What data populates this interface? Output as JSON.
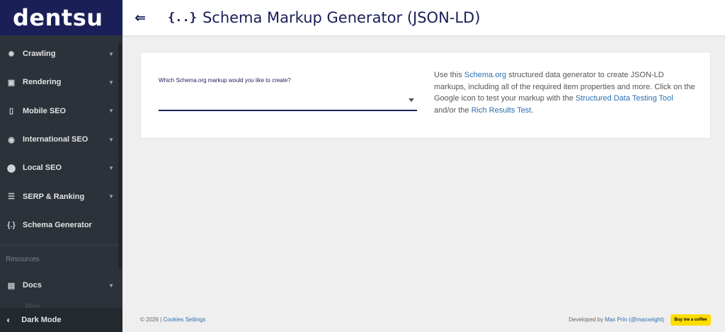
{
  "brand": {
    "logo": "dentsu"
  },
  "sidebar": {
    "items": [
      {
        "label": "Crawling",
        "icon": "bug-icon",
        "glyph": "✹",
        "chevron": "⌄"
      },
      {
        "label": "Rendering",
        "icon": "monitor-icon",
        "glyph": "▣",
        "chevron": "⌄"
      },
      {
        "label": "Mobile SEO",
        "icon": "mobile-icon",
        "glyph": "▯",
        "chevron": "⌄"
      },
      {
        "label": "International SEO",
        "icon": "globe-icon",
        "glyph": "◉",
        "chevron": "⌄"
      },
      {
        "label": "Local SEO",
        "icon": "map-pin-icon",
        "glyph": "⬤",
        "chevron": "⌄"
      },
      {
        "label": "SERP & Ranking",
        "icon": "list-icon",
        "glyph": "☰",
        "chevron": "⌄"
      },
      {
        "label": "Schema Generator",
        "icon": "braces-icon",
        "glyph": "{.}"
      }
    ],
    "resources_title": "Resources",
    "resources": [
      {
        "label": "Docs",
        "icon": "docs-icon",
        "glyph": "▤",
        "chevron": "⌄"
      }
    ],
    "faded_item": "Blog",
    "dark_mode": {
      "label": "Dark Mode",
      "glyph": "◐"
    }
  },
  "header": {
    "toggle_glyph": "⇐",
    "title_glyph": "{..}",
    "title": "Schema Markup Generator (JSON-LD)"
  },
  "form": {
    "select_label": "Which Schema.org markup would you like to create?",
    "select_value": ""
  },
  "description": {
    "t1": "Use this ",
    "link1": "Schema.org",
    "t2": " structured data generator to create JSON-LD markups, including all of the required item properties and more. Click on the Google icon to test your markup with the ",
    "link2": "Structured Data Testing Tool",
    "t3": " and/or the ",
    "link3": "Rich Results Test",
    "t4": "."
  },
  "footer": {
    "copyright": "© 2026 | ",
    "cookies": "Cookies Settings",
    "developed_by": "Developed by ",
    "author": "Max Prin (@maxxeight)",
    "bmc": "Buy me a coffee"
  }
}
